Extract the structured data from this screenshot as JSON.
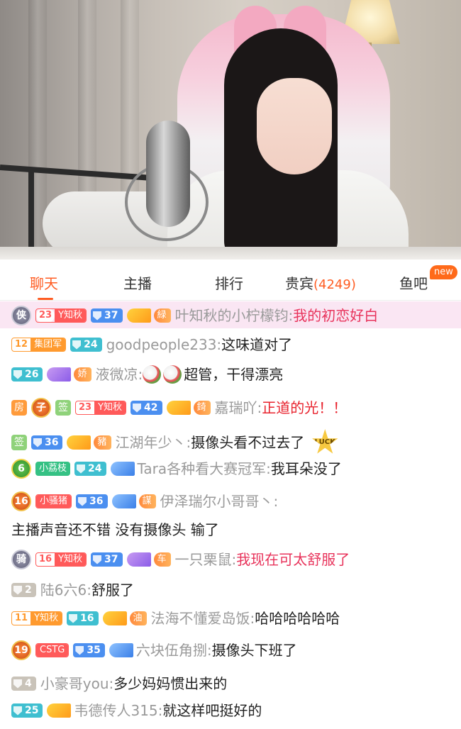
{
  "tabs": [
    {
      "label": "聊天",
      "active": true
    },
    {
      "label": "主播"
    },
    {
      "label": "排行"
    },
    {
      "label": "贵宾",
      "count": "(4249)"
    },
    {
      "label": "鱼吧",
      "badge": "new"
    }
  ],
  "colors": {
    "accent": "#ff5d23",
    "highlight_row": "#fae6f3",
    "username": "#9a9a9a",
    "red_message": "#e8232e"
  },
  "chat": [
    {
      "noble": "侠",
      "fan_level": "23",
      "fan_name": "Y知秋",
      "user_level": "37",
      "medal": "緑",
      "user": "叶知秋的小柠檬钧:",
      "text": "我的初恋好白",
      "highlight": true
    },
    {
      "fan_level": "12",
      "fan_name": "集团军",
      "user_level": "24",
      "user": "goodpeople233:",
      "text": "这味道对了"
    },
    {
      "user_level": "26",
      "medal": "娇",
      "user": "液微凉:",
      "text": "超管，干得漂亮",
      "emojis": 2
    },
    {
      "tag": "房",
      "noble": "子",
      "tag2": "签",
      "fan_level": "23",
      "fan_name": "Y知秋",
      "user_level": "42",
      "medal": "錡",
      "user": "嘉瑞吖:",
      "text": "正道的光！！"
    },
    {
      "tag": "签",
      "user_level": "36",
      "medal": "豬",
      "user": "江湖年少丶:",
      "text": "摄像头看不过去了",
      "luck": "LUCK"
    },
    {
      "noble": "6",
      "fan_name": "小荔枝",
      "user_level": "24",
      "user": "Tara各种看大赛冠军:",
      "text": "我耳朵没了"
    },
    {
      "noble": "16",
      "fan_name": "小骚猪",
      "user_level": "36",
      "medal": "謀",
      "user": "伊泽瑞尔小哥哥丶:",
      "text": "主播声音还不错  没有摄像头  输了"
    },
    {
      "noble": "骑",
      "fan_level": "16",
      "fan_name": "Y知秋",
      "user_level": "37",
      "medal": "车",
      "user": "一只栗鼠:",
      "text": "我现在可太舒服了"
    },
    {
      "user_level": "2",
      "user": "陆6六6:",
      "text": "舒服了"
    },
    {
      "fan_level": "11",
      "fan_name": "Y知秋",
      "user_level": "16",
      "medal": "油",
      "user": "法海不懂爱岛饭:",
      "text": "哈哈哈哈哈哈"
    },
    {
      "noble": "19",
      "fan_name": "CSTG",
      "user_level": "35",
      "user": "六块伍角捌:",
      "text": "摄像头下班了"
    },
    {
      "user_level": "4",
      "user": "小豪哥you:",
      "text": "多少妈妈惯出来的"
    },
    {
      "user_level": "25",
      "user": "韦德传人315:",
      "text": "就这样吧挺好的"
    }
  ]
}
